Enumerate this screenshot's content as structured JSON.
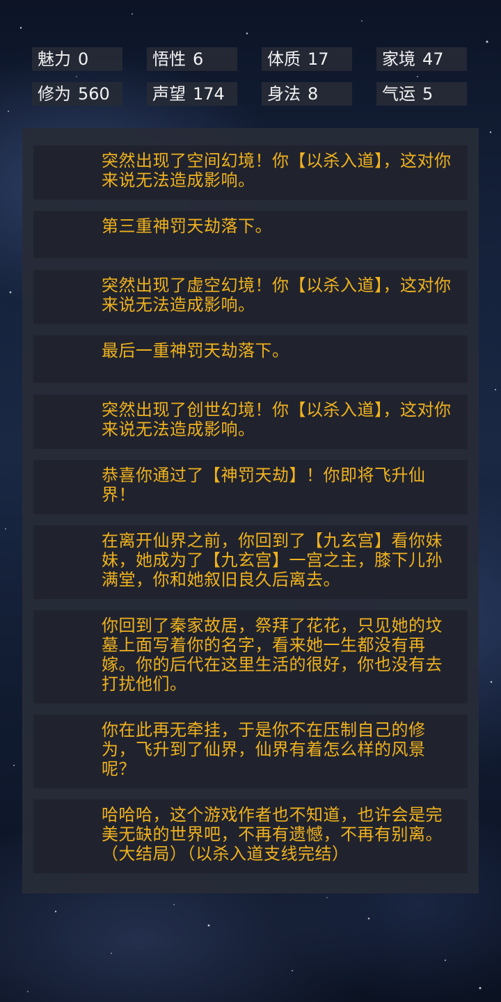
{
  "stats": [
    {
      "label": "魅力",
      "value": "0"
    },
    {
      "label": "悟性",
      "value": "6"
    },
    {
      "label": "体质",
      "value": "17"
    },
    {
      "label": "家境",
      "value": "47"
    },
    {
      "label": "修为",
      "value": "560"
    },
    {
      "label": "声望",
      "value": "174"
    },
    {
      "label": "身法",
      "value": "8"
    },
    {
      "label": "气运",
      "value": "5"
    }
  ],
  "log": [
    "突然出现了空间幻境！你【以杀入道】，这对你来说无法造成影响。",
    "第三重神罚天劫落下。",
    "突然出现了虚空幻境！你【以杀入道】，这对你来说无法造成影响。",
    "最后一重神罚天劫落下。",
    "突然出现了创世幻境！你【以杀入道】，这对你来说无法造成影响。",
    "恭喜你通过了【神罚天劫】！你即将飞升仙界！",
    "在离开仙界之前，你回到了【九玄宫】看你妹妹，她成为了【九玄宫】一宫之主，膝下儿孙满堂，你和她叙旧良久后离去。",
    "你回到了秦家故居，祭拜了花花，只见她的坟墓上面写着你的名字，看来她一生都没有再嫁。你的后代在这里生活的很好，你也没有去打扰他们。",
    "你在此再无牵挂，于是你不在压制自己的修为，飞升到了仙界，仙界有着怎么样的风景呢？",
    "哈哈哈，这个游戏作者也不知道，也许会是完美无缺的世界吧，不再有遗憾，不再有别离。（大结局）（以杀入道支线完结）"
  ],
  "colors": {
    "text_accent": "#f0b21e",
    "stat_text": "#f2f2f2",
    "panel_bg": "#282c38",
    "card_bg": "#20232e"
  }
}
